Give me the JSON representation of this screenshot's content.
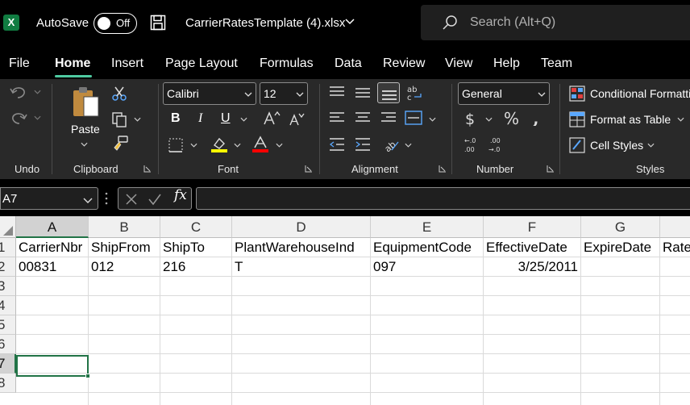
{
  "titlebar": {
    "autosave_label": "AutoSave",
    "autosave_state": "Off",
    "filename": "CarrierRatesTemplate (4).xlsx",
    "search_placeholder": "Search (Alt+Q)",
    "app_icon": "excel-icon"
  },
  "tabs": [
    {
      "label": "File"
    },
    {
      "label": "Home",
      "active": true
    },
    {
      "label": "Insert"
    },
    {
      "label": "Page Layout"
    },
    {
      "label": "Formulas"
    },
    {
      "label": "Data"
    },
    {
      "label": "Review"
    },
    {
      "label": "View"
    },
    {
      "label": "Help"
    },
    {
      "label": "Team"
    }
  ],
  "ribbon": {
    "groups": {
      "undo": "Undo",
      "clipboard": "Clipboard",
      "font": "Font",
      "alignment": "Alignment",
      "number": "Number",
      "styles": "Styles"
    },
    "paste_label": "Paste",
    "font_name": "Calibri",
    "font_size": "12",
    "number_format": "General",
    "conditional_formatting": "Conditional Formatting",
    "format_as_table": "Format as Table",
    "cell_styles": "Cell Styles",
    "bold": "B",
    "italic": "I",
    "underline": "U",
    "highlight_color": "#ffff00",
    "font_color": "#ff0000"
  },
  "formula_bar": {
    "name_box": "A7",
    "fx": "fx",
    "content": ""
  },
  "sheet": {
    "columns": [
      "A",
      "B",
      "C",
      "D",
      "E",
      "F",
      "G"
    ],
    "rows": [
      "1",
      "2",
      "3",
      "4",
      "5",
      "6",
      "7",
      "8"
    ],
    "selected_cell": "A7",
    "header_row": [
      "CarrierNbr",
      "ShipFrom",
      "ShipTo",
      "PlantWarehouseInd",
      "EquipmentCode",
      "EffectiveDate",
      "ExpireDate",
      "Rate"
    ],
    "data_row": [
      "00831",
      "012",
      "216",
      "T",
      "097",
      "3/25/2011",
      "",
      ""
    ]
  }
}
